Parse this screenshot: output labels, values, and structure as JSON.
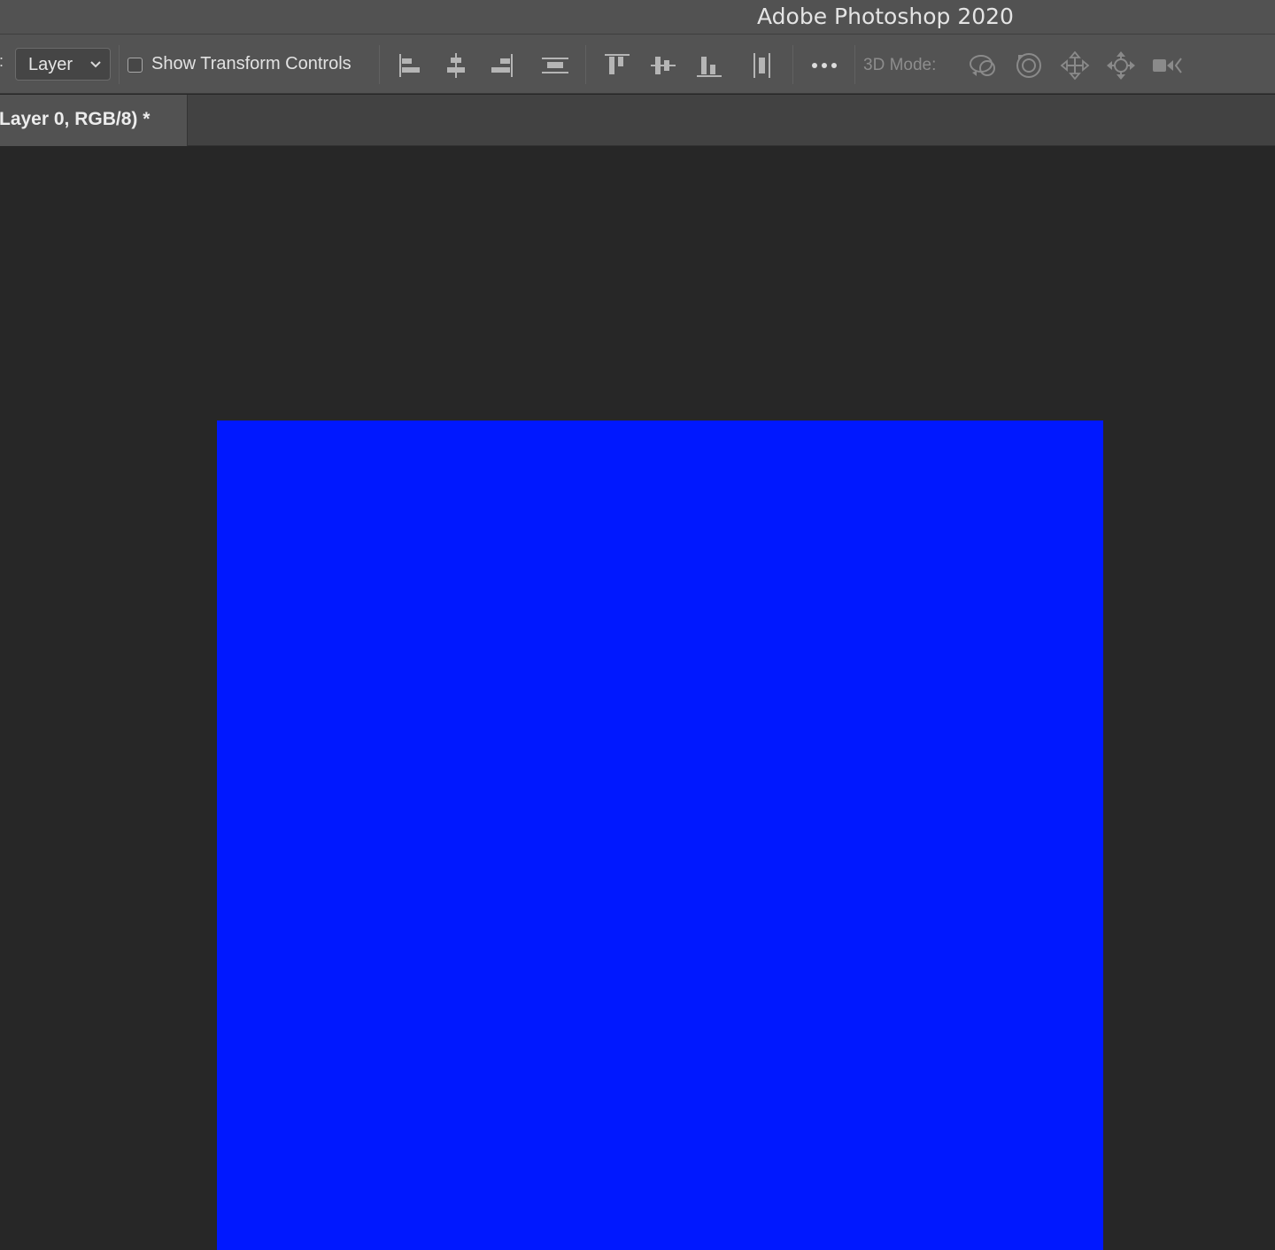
{
  "window": {
    "title": "Adobe Photoshop 2020"
  },
  "options_bar": {
    "leading_colon": ":",
    "auto_select_target": "Layer",
    "show_transform_controls": {
      "label": "Show Transform Controls",
      "checked": false
    },
    "align_icons": [
      "align-left-edges-icon",
      "align-horizontal-centers-icon",
      "align-right-edges-icon",
      "distribute-vertical-icon",
      "align-top-edges-icon",
      "align-vertical-centers-icon",
      "align-bottom-edges-icon",
      "distribute-horizontal-icon",
      "more-options-icon"
    ],
    "mode_3d": {
      "label": "3D Mode:",
      "icons": [
        "orbit-3d-icon",
        "roll-3d-icon",
        "drag-3d-icon",
        "slide-3d-icon",
        "scale-3d-icon"
      ]
    }
  },
  "document_tab": {
    "label": "Layer 0, RGB/8) *"
  },
  "canvas": {
    "fill_color": "#0018ff"
  },
  "colors": {
    "canvas_blue": "#0018ff",
    "workspace": "#272727",
    "toolbar": "#535353"
  }
}
